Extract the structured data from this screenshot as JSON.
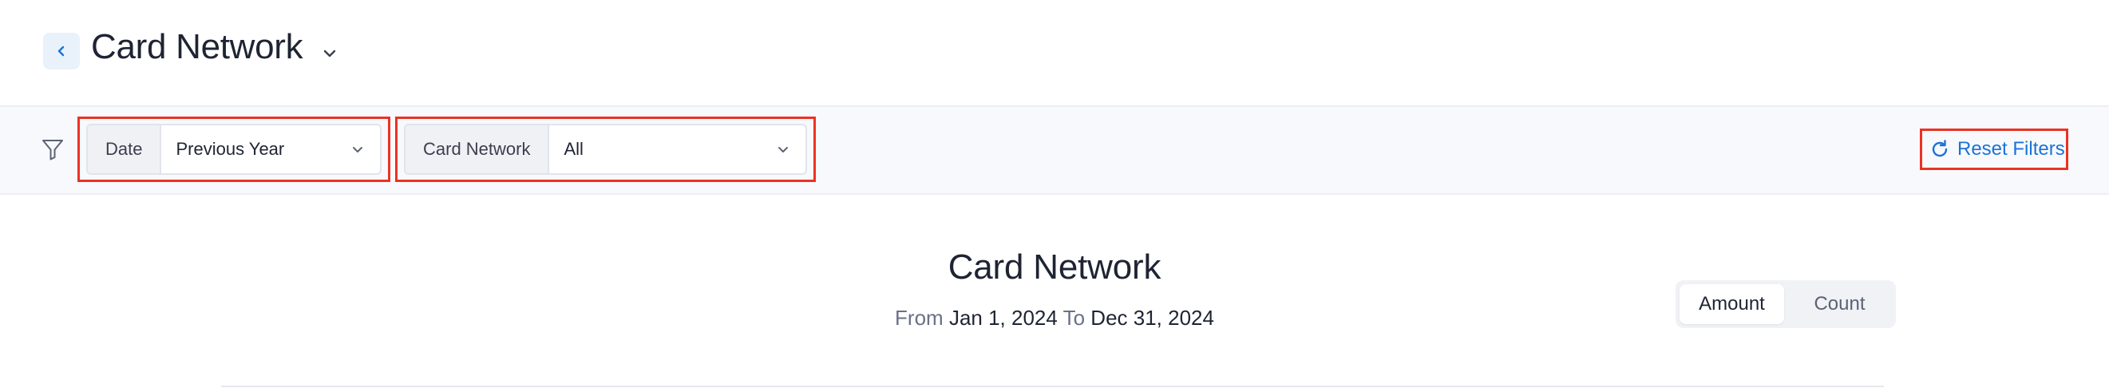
{
  "header": {
    "title": "Card Network",
    "back_icon": "chevron-left-icon",
    "title_menu_icon": "chevron-down-icon"
  },
  "filters": {
    "filter_icon": "filter-funnel-icon",
    "date": {
      "label": "Date",
      "value": "Previous Year"
    },
    "card_network": {
      "label": "Card Network",
      "value": "All"
    },
    "reset_label": "Reset Filters"
  },
  "report": {
    "title": "Card Network",
    "range_from_word": "From",
    "range_start": "Jan 1, 2024",
    "range_to_word": "To",
    "range_end": "Dec 31, 2024"
  },
  "toggle": {
    "options": [
      {
        "label": "Amount",
        "active": true
      },
      {
        "label": "Count",
        "active": false
      }
    ]
  },
  "colors": {
    "accent": "#1a73d9",
    "highlight_border": "#ea3323",
    "text_primary": "#1f2433"
  }
}
